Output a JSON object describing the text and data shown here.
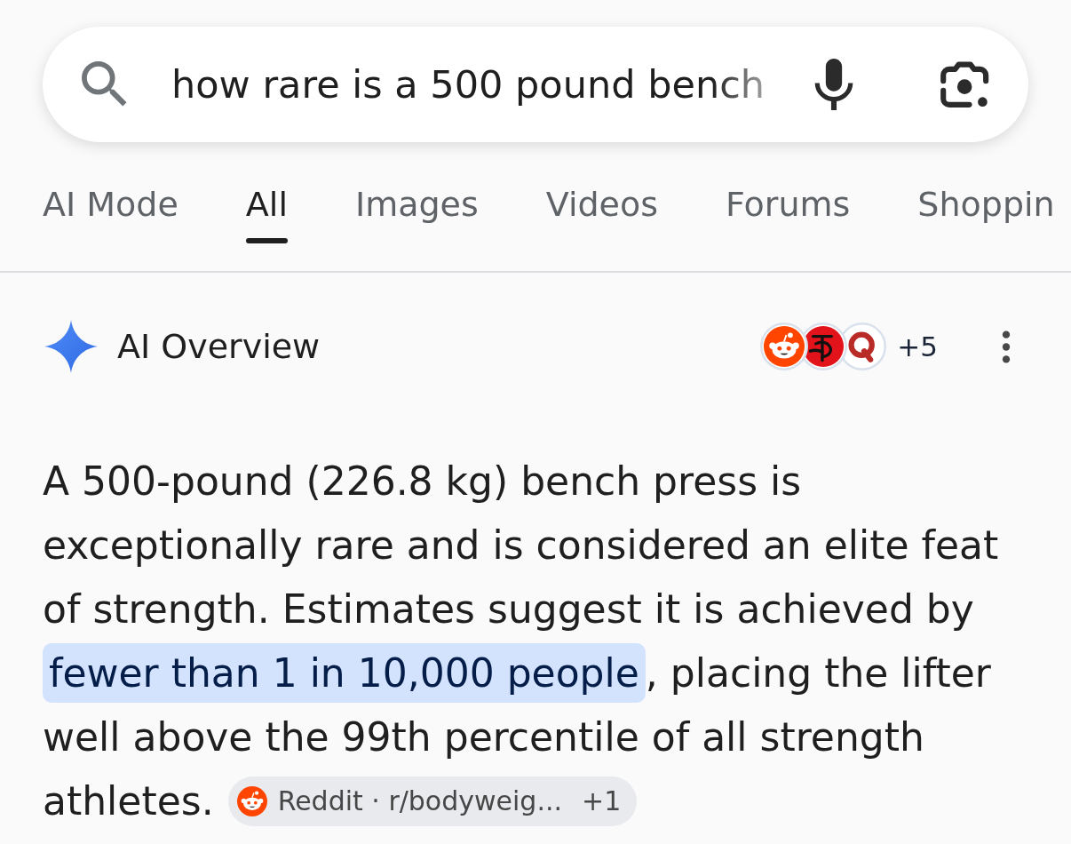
{
  "search": {
    "value": "how rare is a 500 pound bench"
  },
  "tabs": [
    {
      "label": "AI Mode",
      "selected": false
    },
    {
      "label": "All",
      "selected": true
    },
    {
      "label": "Images",
      "selected": false
    },
    {
      "label": "Videos",
      "selected": false
    },
    {
      "label": "Forums",
      "selected": false
    },
    {
      "label": "Shoppin",
      "selected": false
    }
  ],
  "ai_overview": {
    "title": "AI Overview",
    "more_sources": "+5",
    "summary": {
      "before": "A 500-pound (226.8 kg) bench press is exceptionally rare and is considered an elite feat of strength. Estimates suggest it is achieved by",
      "highlight": "fewer than 1 in 10,000 people",
      "after": ", placing the lifter well above the 99th percentile of all strength athletes."
    },
    "citation": {
      "label": "Reddit · r/bodyweig...",
      "more": "+1"
    }
  }
}
